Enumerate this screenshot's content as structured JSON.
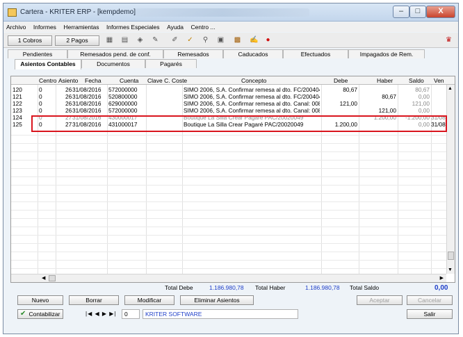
{
  "window": {
    "title": "Cartera - KRITER ERP - [kempdemo]",
    "min_glyph": "–",
    "max_glyph": "□",
    "close_glyph": "X"
  },
  "menu": [
    "Archivo",
    "Informes",
    "Herramientas",
    "Informes Especiales",
    "Ayuda",
    "Centro ..."
  ],
  "toolbar": {
    "cobros_label": "1 Cobros",
    "pagos_label": "2 Pagos",
    "icons": [
      "grid-icon",
      "calendar-icon",
      "tag-icon",
      "edit-icon",
      "pencil-icon",
      "check-icon",
      "link-icon",
      "calc-icon",
      "chart-icon",
      "script-icon",
      "dot-icon",
      "help-icon"
    ]
  },
  "tabs_primary": [
    "Pendientes",
    "Remesados pend. de conf.",
    "Remesados",
    "Caducados",
    "Efectuados",
    "Impagados de Rem."
  ],
  "tabs_secondary": [
    "Asientos Contables",
    "Documentos",
    "Pagarés"
  ],
  "grid": {
    "columns": [
      "Centro",
      "Asiento",
      "Fecha",
      "Cuenta",
      "Clave C. Coste",
      "Concepto",
      "Debe",
      "Haber",
      "Saldo",
      "Ven"
    ],
    "rows": [
      {
        "num": "120",
        "centro": "0",
        "asiento": "26",
        "fecha": "31/08/2016",
        "cuenta": "572000000",
        "clave": "",
        "concepto": "SIMO 2006, S.A. Confirmar remesa al dto. FC/20040422/",
        "debe": "80,67",
        "haber": "",
        "saldo": "80,67",
        "ven": ""
      },
      {
        "num": "121",
        "centro": "0",
        "asiento": "26",
        "fecha": "31/08/2016",
        "cuenta": "520800000",
        "clave": "",
        "concepto": "SIMO 2006, S.A. Confirmar remesa al dto. FC/20040422/",
        "debe": "",
        "haber": "80,67",
        "saldo": "0,00",
        "ven": ""
      },
      {
        "num": "122",
        "centro": "0",
        "asiento": "26",
        "fecha": "31/08/2016",
        "cuenta": "629000000",
        "clave": "",
        "concepto": "SIMO 2006, S.A. Confirmar remesa al dto. Canal: 0085 Ba",
        "debe": "121,00",
        "haber": "",
        "saldo": "121,00",
        "ven": ""
      },
      {
        "num": "123",
        "centro": "0",
        "asiento": "26",
        "fecha": "31/08/2016",
        "cuenta": "572000000",
        "clave": "",
        "concepto": "SIMO 2006, S.A. Confirmar remesa al dto. Canal: 0085 Ba",
        "debe": "",
        "haber": "121,00",
        "saldo": "0,00",
        "ven": ""
      },
      {
        "num": "124",
        "centro": "0",
        "asiento": "27",
        "fecha": "31/08/2016",
        "cuenta": "430000017",
        "clave": "",
        "concepto": "Boutique La Silla Crear Pagaré PAC/20020049",
        "debe": "",
        "haber": "1.200,00",
        "saldo": "-1.200,00",
        "ven": "31/08"
      },
      {
        "num": "125",
        "centro": "0",
        "asiento": "27",
        "fecha": "31/08/2016",
        "cuenta": "431000017",
        "clave": "",
        "concepto": "Boutique La Silla Crear Pagaré PAC/20020049",
        "debe": "1.200,00",
        "haber": "",
        "saldo": "0,00",
        "ven": "31/08"
      }
    ]
  },
  "totals": {
    "debe_label": "Total Debe",
    "debe_value": "1.186.980,78",
    "haber_label": "Total Haber",
    "haber_value": "1.186.980,78",
    "saldo_label": "Total Saldo",
    "saldo_value": "0,00"
  },
  "buttons": {
    "nuevo": "Nuevo",
    "borrar": "Borrar",
    "modificar": "Modificar",
    "eliminar": "Eliminar Asientos",
    "aceptar": "Aceptar",
    "cancelar": "Cancelar",
    "contabilizar": "Contabilizar",
    "salir": "Salir"
  },
  "footer": {
    "record_value": "0",
    "company": "KRITER SOFTWARE"
  }
}
